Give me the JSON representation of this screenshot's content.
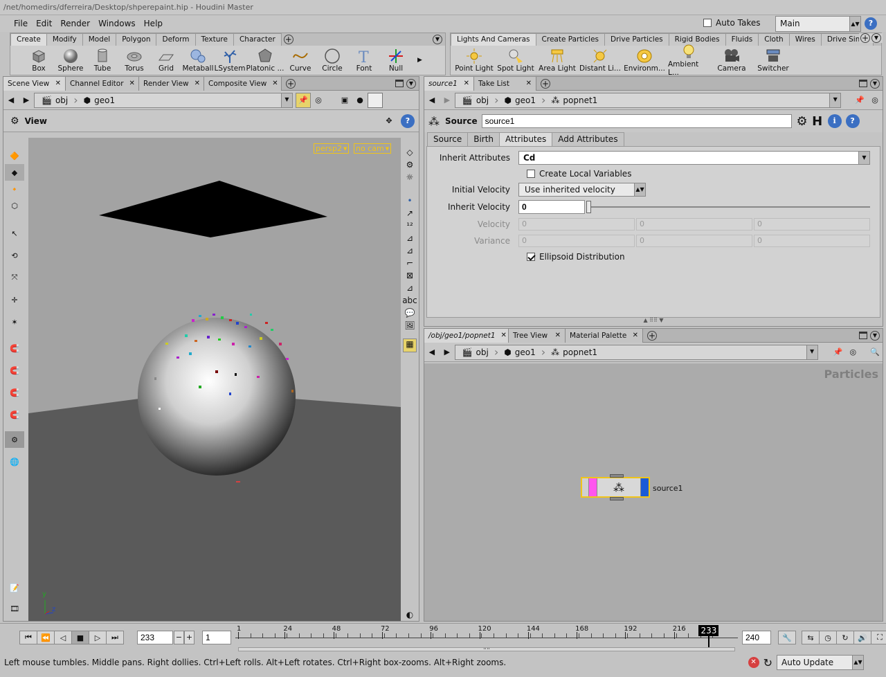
{
  "window": {
    "title": "/net/homedirs/dferreira/Desktop/shperepaint.hip - Houdini Master"
  },
  "menubar": {
    "items": [
      "File",
      "Edit",
      "Render",
      "Windows",
      "Help"
    ],
    "auto_takes_label": "Auto Takes",
    "auto_takes_checked": false,
    "desktop": "Main"
  },
  "shelf_left": {
    "tabs": [
      "Create",
      "Modify",
      "Model",
      "Polygon",
      "Deform",
      "Texture",
      "Character"
    ],
    "active_tab": "Create",
    "tools": [
      "Box",
      "Sphere",
      "Tube",
      "Torus",
      "Grid",
      "Metaball",
      "LSystem",
      "Platonic ...",
      "Curve",
      "Circle",
      "Font",
      "Null"
    ]
  },
  "shelf_right": {
    "tabs": [
      "Lights And Cameras",
      "Create Particles",
      "Drive Particles",
      "Rigid Bodies",
      "Fluids",
      "Cloth",
      "Wires",
      "Drive Simu"
    ],
    "active_tab": "Lights And Cameras",
    "tools": [
      "Point Light",
      "Spot Light",
      "Area Light",
      "Distant Li...",
      "Environm...",
      "Ambient L...",
      "Camera",
      "Switcher"
    ]
  },
  "left_pane": {
    "tabs": [
      "Scene View",
      "Channel Editor",
      "Render View",
      "Composite View"
    ],
    "active_tab": "Scene View",
    "path": [
      "obj",
      "geo1"
    ],
    "toolbar_title": "View",
    "viewport": {
      "camera_menu": "persp2",
      "cam_menu": "no cam",
      "axis_y": "y",
      "axis_z": "z"
    }
  },
  "param_pane": {
    "tabs": [
      "source1",
      "Take List"
    ],
    "active_tab": "source1",
    "path": [
      "obj",
      "geo1",
      "popnet1"
    ],
    "node_type": "Source",
    "node_name": "source1",
    "ptabs": [
      "Source",
      "Birth",
      "Attributes",
      "Add Attributes"
    ],
    "active_ptab": "Attributes",
    "inherit_attributes_label": "Inherit Attributes",
    "inherit_attributes_value": "Cd",
    "create_local_label": "Create Local Variables",
    "create_local_checked": false,
    "initial_velocity_label": "Initial Velocity",
    "initial_velocity_value": "Use inherited velocity",
    "inherit_velocity_label": "Inherit Velocity",
    "inherit_velocity_value": "0",
    "velocity_label": "Velocity",
    "velocity_values": [
      "0",
      "0",
      "0"
    ],
    "variance_label": "Variance",
    "variance_values": [
      "0",
      "0",
      "0"
    ],
    "ellipsoid_label": "Ellipsoid Distribution",
    "ellipsoid_checked": true
  },
  "network_pane": {
    "tabs": [
      "/obj/geo1/popnet1",
      "Tree View",
      "Material Palette"
    ],
    "active_tab": "/obj/geo1/popnet1",
    "path": [
      "obj",
      "geo1",
      "popnet1"
    ],
    "context_label": "Particles",
    "node_label": "source1"
  },
  "timeline": {
    "current_frame": "233",
    "start_frame": "1",
    "end_frame": "240",
    "ticks": [
      "1",
      "24",
      "48",
      "72",
      "96",
      "120",
      "144",
      "168",
      "192",
      "216"
    ],
    "cursor_label": "233"
  },
  "status": {
    "message": "Left mouse tumbles. Middle pans. Right dollies. Ctrl+Left rolls. Alt+Left rotates. Ctrl+Right box-zooms. Alt+Right zooms.",
    "update_mode": "Auto Update"
  },
  "colors": {
    "accent_yellow": "#f0c419",
    "node_pink": "#ff55ee",
    "node_blue": "#1a5bd6",
    "viewport_bg": "#a3a3a3",
    "floor": "#5a5a5a"
  }
}
